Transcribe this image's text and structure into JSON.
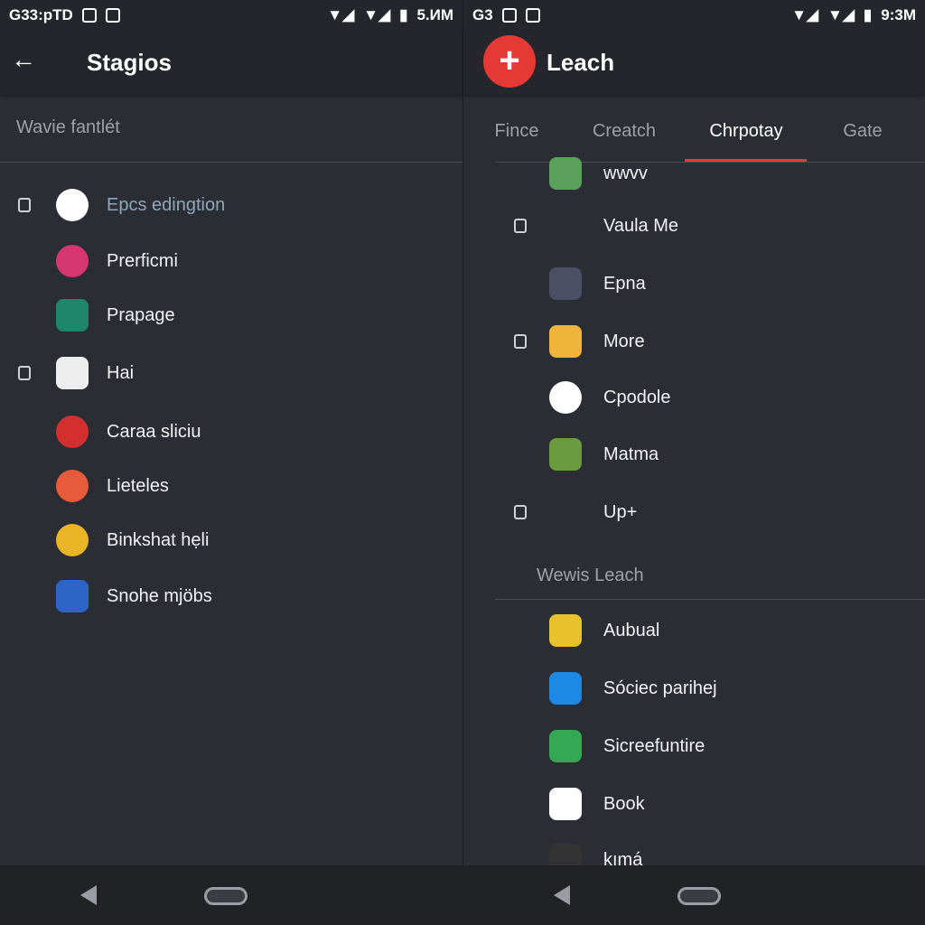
{
  "left": {
    "status": {
      "left_text": "G33:pTD",
      "time": "5.ИM"
    },
    "title": "Stagios",
    "subheader": "Wavie fantlét",
    "items": [
      {
        "label": "Epcs edingtion",
        "icon": "chrome-icon",
        "color": "#ffffff",
        "checkbox": true,
        "muted": true
      },
      {
        "label": "Prerficmi",
        "icon": "instagram-icon",
        "color": "#d6366f",
        "checkbox": false
      },
      {
        "label": "Prapage",
        "icon": "lock-app-icon",
        "color": "#20866a",
        "checkbox": false
      },
      {
        "label": "Hai",
        "icon": "play-store-icon",
        "color": "#eeeeee",
        "checkbox": true
      },
      {
        "label": "Caraa sliciu",
        "icon": "music-icon",
        "color": "#d32f2f",
        "checkbox": false
      },
      {
        "label": "Lieteles",
        "icon": "flag-app-icon",
        "color": "#e85a3c",
        "checkbox": false
      },
      {
        "label": "Binkshat hẹli",
        "icon": "badge-app-icon",
        "color": "#e9b526",
        "checkbox": false
      },
      {
        "label": "Snohe mjöbs",
        "icon": "folder-app-icon",
        "color": "#2f64c7",
        "checkbox": false
      }
    ]
  },
  "right": {
    "status": {
      "left_text": "G3",
      "time": "9:3M"
    },
    "title": "Leach",
    "add_button": "+",
    "tabs": [
      {
        "label": "Fince"
      },
      {
        "label": "Creatch"
      },
      {
        "label": "Chrpotay",
        "active": true
      },
      {
        "label": "Gate"
      }
    ],
    "items": [
      {
        "label": "wwvv",
        "icon": "photos-app-icon",
        "color": "#5aa05a",
        "checkbox": false
      },
      {
        "label": "Vaula Me",
        "icon": "list-app-icon",
        "color": "#2b2d34",
        "checkbox": true
      },
      {
        "label": "Epna",
        "icon": "search-camera-icon",
        "color": "#4a4f66",
        "checkbox": false
      },
      {
        "label": "More",
        "icon": "mail-app-icon",
        "color": "#f0b43a",
        "checkbox": true
      },
      {
        "label": "Cpodole",
        "icon": "photos-pinwheel-icon",
        "color": "#ffffff",
        "checkbox": false
      },
      {
        "label": "Matma",
        "icon": "gallery-app-icon",
        "color": "#6a9a3e",
        "checkbox": false
      },
      {
        "label": "Up+",
        "icon": "facebook-icon",
        "color": "#2b2d34",
        "checkbox": true
      }
    ],
    "section_title": "Wewis Leach",
    "section_items": [
      {
        "label": "Aubual",
        "icon": "shield-star-icon",
        "color": "#e8c22c"
      },
      {
        "label": "Sóciec parihej",
        "icon": "vpn-app-icon",
        "color": "#1e88e5"
      },
      {
        "label": "Sicreefuntire",
        "icon": "maps-icon",
        "color": "#34a853"
      },
      {
        "label": "Book",
        "icon": "play-store-icon",
        "color": "#ffffff"
      },
      {
        "label": "kımá",
        "icon": "camera-app-icon",
        "color": "#333333"
      }
    ]
  },
  "nav": {
    "back": "back",
    "home": "home"
  }
}
